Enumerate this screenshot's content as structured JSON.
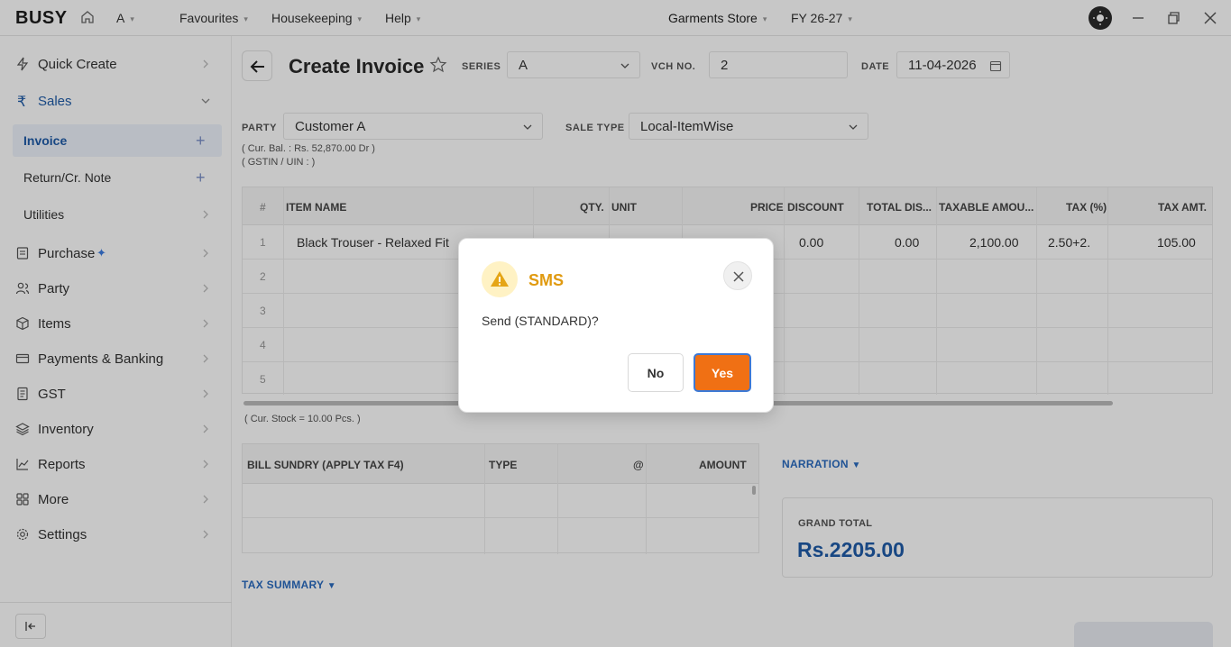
{
  "topbar": {
    "logo": "BUSY",
    "company_code": "A",
    "menu": [
      "Favourites",
      "Housekeeping",
      "Help"
    ],
    "company_name": "Garments Store",
    "fiscal_year": "FY 26-27"
  },
  "sidebar": {
    "quick_create": "Quick Create",
    "sales": "Sales",
    "sales_items": [
      "Invoice",
      "Return/Cr. Note",
      "Utilities"
    ],
    "items": [
      "Purchase",
      "Party",
      "Items",
      "Payments & Banking",
      "GST",
      "Inventory",
      "Reports",
      "More",
      "Settings"
    ]
  },
  "header": {
    "title": "Create Invoice",
    "series_label": "SERIES",
    "series_value": "A",
    "vch_label": "VCH NO.",
    "vch_value": "2",
    "date_label": "DATE",
    "date_value": "11-04-2026"
  },
  "party": {
    "label": "PARTY",
    "value": "Customer A",
    "sale_type_label": "SALE TYPE",
    "sale_type_value": "Local-ItemWise",
    "balance": "( Cur. Bal. : Rs. 52,870.00 Dr )",
    "gstin": "( GSTIN / UIN :  )"
  },
  "items_grid": {
    "columns": [
      "#",
      "ITEM NAME",
      "QTY.",
      "UNIT",
      "PRICE",
      "DISCOUNT",
      "TOTAL DIS...",
      "TAXABLE AMOU...",
      "TAX (%)",
      "TAX AMT."
    ],
    "row_numbers": [
      "1",
      "2",
      "3",
      "4",
      "5"
    ],
    "row1": {
      "item": "Black Trouser - Relaxed Fit",
      "discount": "0.00",
      "total_discount": "0.00",
      "taxable": "2,100.00",
      "tax_pct": "2.50+2.",
      "tax_amt": "105.00"
    },
    "stock_note": "( Cur. Stock = 10.00  Pcs. )"
  },
  "sundry": {
    "columns": [
      "BILL SUNDRY (APPLY TAX F4)",
      "TYPE",
      "@",
      "AMOUNT"
    ]
  },
  "narration_label": "NARRATION",
  "tax_summary_label": "TAX SUMMARY",
  "grand_total": {
    "label": "GRAND TOTAL",
    "value": "Rs.2205.00"
  },
  "dialog": {
    "title": "SMS",
    "message": "Send (STANDARD)?",
    "no_label": "No",
    "yes_label": "Yes"
  },
  "colors": {
    "accent": "#1f5ca8",
    "warning": "#e09a10",
    "primary_button": "#f07014"
  }
}
